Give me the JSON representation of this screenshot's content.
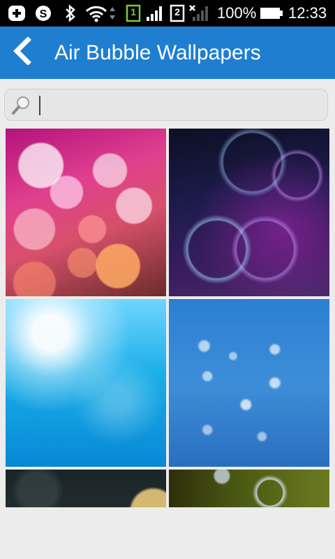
{
  "status_bar": {
    "battery_percent": "100%",
    "time": "12:33",
    "sim1": "1",
    "sim2": "2",
    "icons": [
      "notification-plus-icon",
      "skype-icon",
      "bluetooth-icon",
      "wifi-icon",
      "data-arrows-icon",
      "sim1-icon",
      "signal-icon",
      "sim2-icon",
      "signal-no-service-icon",
      "battery-icon"
    ]
  },
  "app_bar": {
    "title": "Air Bubble Wallpapers",
    "color": "#1f7ed0",
    "back_icon": "chevron-left-icon"
  },
  "search": {
    "value": "",
    "icon": "magnifier-icon"
  },
  "wallpapers": [
    {
      "theme": "pink bokeh bubbles"
    },
    {
      "theme": "purple glowing bubbles"
    },
    {
      "theme": "blue underwater bubbles"
    },
    {
      "theme": "water droplets on blue"
    },
    {
      "theme": "dark bokeh bubble"
    },
    {
      "theme": "soap bubble on green"
    }
  ]
}
